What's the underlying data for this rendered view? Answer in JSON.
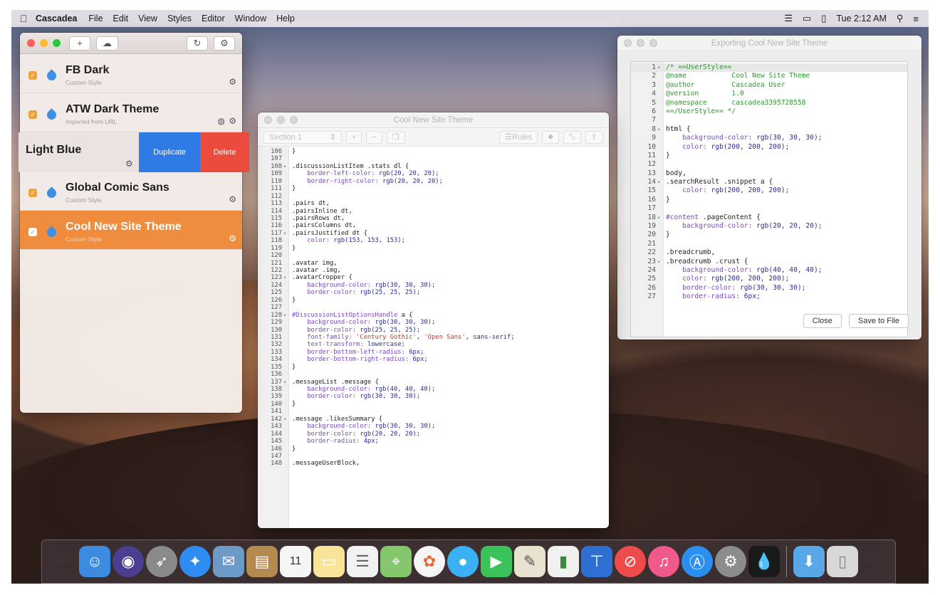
{
  "menubar": {
    "app": "Cascadea",
    "items": [
      "File",
      "Edit",
      "View",
      "Styles",
      "Editor",
      "Window",
      "Help"
    ],
    "time": "Tue 2:12 AM"
  },
  "styles_window": {
    "toolbar": {
      "add": "+",
      "cloud": "☁",
      "refresh": "↻",
      "gear": "⚙"
    },
    "rows": [
      {
        "title": "FB Dark",
        "subtitle": "Custom Style"
      },
      {
        "title": "ATW Dark Theme",
        "subtitle": "Imported from URL"
      },
      {
        "title": "Global Comic Sans",
        "subtitle": "Custom Style"
      },
      {
        "title": "Cool New Site Theme",
        "subtitle": "Custom Style"
      }
    ],
    "swipe_row": {
      "title": "Light Blue",
      "duplicate": "Duplicate",
      "delete": "Delete"
    }
  },
  "editor_window": {
    "title": "Cool New Site Theme",
    "toolbar": {
      "section": "Section 1",
      "rules": "Rules"
    }
  },
  "export_window": {
    "title": "Exporting Cool New Site Theme",
    "close": "Close",
    "save": "Save to File"
  }
}
